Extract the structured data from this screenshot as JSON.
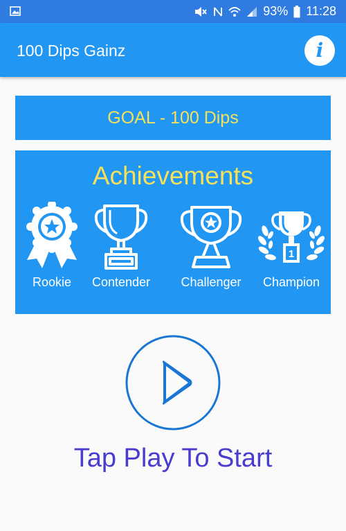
{
  "status_bar": {
    "left_icon": "image-icon",
    "battery_percent": "93%",
    "time": "11:28",
    "icons": [
      "mute-icon",
      "nfc-icon",
      "wifi-icon",
      "signal-icon",
      "battery-icon"
    ]
  },
  "app_bar": {
    "title": "100 Dips Gainz",
    "info_icon": "info-icon",
    "info_glyph": "i"
  },
  "goal": {
    "text": "GOAL - 100 Dips"
  },
  "achievements": {
    "title": "Achievements",
    "badges": [
      {
        "label": "Rookie",
        "icon": "rosette-icon"
      },
      {
        "label": "Contender",
        "icon": "trophy-outline-icon"
      },
      {
        "label": "Challenger",
        "icon": "trophy-star-icon"
      },
      {
        "label": "Champion",
        "icon": "trophy-laurel-icon"
      }
    ],
    "champion_rank": "1"
  },
  "play": {
    "icon": "play-icon",
    "prompt": "Tap Play To Start"
  },
  "colors": {
    "primary": "#2196f3",
    "status_bar": "#2f7be0",
    "accent_yellow": "#f5e15a",
    "prompt_text": "#4a3ccf",
    "play_button": "#1976d2"
  }
}
